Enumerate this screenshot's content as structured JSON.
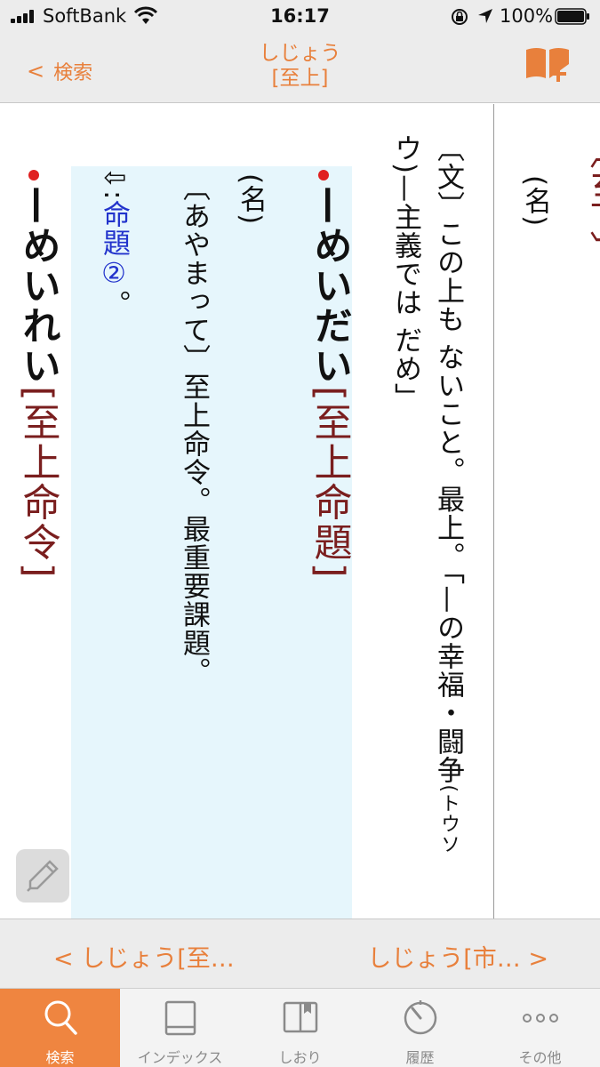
{
  "status_bar": {
    "carrier": "SoftBank",
    "time": "16:17",
    "battery_percent": "100%"
  },
  "nav": {
    "back_label": "検索",
    "title_reading": "しじょう",
    "title_kanji": "[至上]"
  },
  "entries": {
    "shijou_def": {
      "col1_label": "〔文〕",
      "col1_text": "この上も ないこと。最上。「—の幸福・闘争",
      "col1_small": "(トウソ",
      "col2_text": "ウ)—主義では だめ」"
    },
    "shijou_pos": "(名)",
    "meidai": {
      "headword": "—めいだい",
      "kanji": "[至上命題]",
      "pos": "(名)",
      "def": "〔あやまって〕至上命令。最重要課題。",
      "ref_arrow": "⇩:",
      "ref_link": "命題②",
      "ref_end": "。"
    },
    "meirei": {
      "headword": "—めいれい",
      "kanji": "[至上命令]"
    }
  },
  "pager": {
    "prev_label": "< しじょう[至…",
    "next_label": "しじょう[市… >"
  },
  "tabs": [
    {
      "label": "検索",
      "icon": "search-icon",
      "active": true
    },
    {
      "label": "インデックス",
      "icon": "book-icon",
      "active": false
    },
    {
      "label": "しおり",
      "icon": "bookmark-icon",
      "active": false
    },
    {
      "label": "履歴",
      "icon": "history-icon",
      "active": false
    },
    {
      "label": "その他",
      "icon": "more-icon",
      "active": false
    }
  ],
  "colors": {
    "accent": "#e8803c",
    "headword_kanji": "#7a1e1e",
    "link": "#2233cc",
    "highlight": "#e6f6fc",
    "active_tab": "#ef8540"
  }
}
